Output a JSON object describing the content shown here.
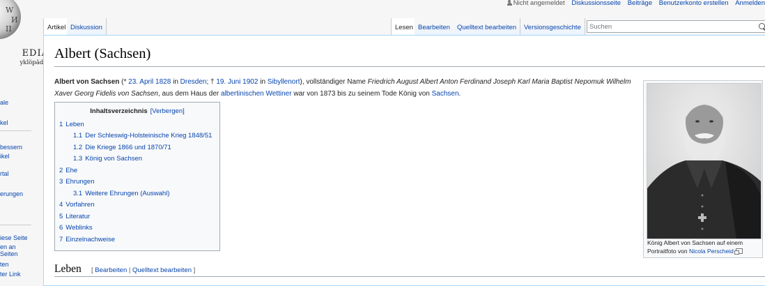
{
  "logo": {
    "wordmark": "EDIA",
    "tagline": "yklöpädie",
    "glyphs": [
      "W",
      "И",
      "II"
    ]
  },
  "sidebar": {
    "items": [
      "ale",
      "kel",
      "bessern",
      "ikel",
      "rtal",
      "erungen",
      "iese Seite",
      "en an",
      "Seiten",
      "ten",
      "ter Link"
    ]
  },
  "personal_tools": {
    "not_logged_in": "Nicht angemeldet",
    "talk": "Diskussionsseite",
    "contributions": "Beiträge",
    "create_account": "Benutzerkonto erstellen",
    "login": "Anmelden"
  },
  "tabs": {
    "left": [
      {
        "label": "Artikel",
        "selected": true
      },
      {
        "label": "Diskussion",
        "selected": false
      }
    ],
    "right": [
      {
        "label": "Lesen",
        "selected": true
      },
      {
        "label": "Bearbeiten",
        "selected": false
      },
      {
        "label": "Quelltext bearbeiten",
        "selected": false
      },
      {
        "label": "Versionsgeschichte",
        "selected": false
      }
    ]
  },
  "search": {
    "placeholder": "Suchen",
    "value": ""
  },
  "article": {
    "title": "Albert (Sachsen)",
    "lead": {
      "name_bold": "Albert von Sachsen",
      "paren_open": " (* ",
      "birth_date": "23. April 1828",
      "in1": " in ",
      "birth_place": "Dresden",
      "sep": "; † ",
      "death_date": "19. Juni 1902",
      "in2": " in ",
      "death_place": "Sibyllenort",
      "after_place": "), vollständiger Name ",
      "full_name": "Friedrich August Albert Anton Ferdinand Joseph Karl Maria Baptist Nepomuk Wilhelm Xaver Georg Fidelis von Sachsen",
      "mid": ", aus dem Haus der ",
      "house": "albertinischen Wettiner",
      "rest": " war von 1873 bis zu seinem Tode König von ",
      "country": "Sachsen",
      "end": "."
    }
  },
  "toc": {
    "title": "Inhaltsverzeichnis",
    "hide_label": "[Verbergen]",
    "entries": [
      {
        "num": "1",
        "label": "Leben",
        "level": 1
      },
      {
        "num": "1.1",
        "label": "Der Schleswig-Holsteinische Krieg 1848/51",
        "level": 2
      },
      {
        "num": "1.2",
        "label": "Die Kriege 1866 und 1870/71",
        "level": 2
      },
      {
        "num": "1.3",
        "label": "König von Sachsen",
        "level": 2
      },
      {
        "num": "2",
        "label": "Ehe",
        "level": 1
      },
      {
        "num": "3",
        "label": "Ehrungen",
        "level": 1
      },
      {
        "num": "3.1",
        "label": "Weitere Ehrungen (Auswahl)",
        "level": 2
      },
      {
        "num": "4",
        "label": "Vorfahren",
        "level": 1
      },
      {
        "num": "5",
        "label": "Literatur",
        "level": 1
      },
      {
        "num": "6",
        "label": "Weblinks",
        "level": 1
      },
      {
        "num": "7",
        "label": "Einzelnachweise",
        "level": 1
      }
    ]
  },
  "thumbnail": {
    "caption_text": "König Albert von Sachsen auf einem Portraitfoto von ",
    "caption_link": "Nicola Perscheid"
  },
  "section": {
    "heading": "Leben",
    "edit_open": "[ ",
    "edit_label": "Bearbeiten",
    "edit_sep": " | ",
    "source_edit_label": "Quelltext bearbeiten",
    "edit_close": " ]"
  },
  "colors": {
    "link": "#0645ad",
    "content_border": "#a7d7f9",
    "background": "#f6f6f6"
  }
}
